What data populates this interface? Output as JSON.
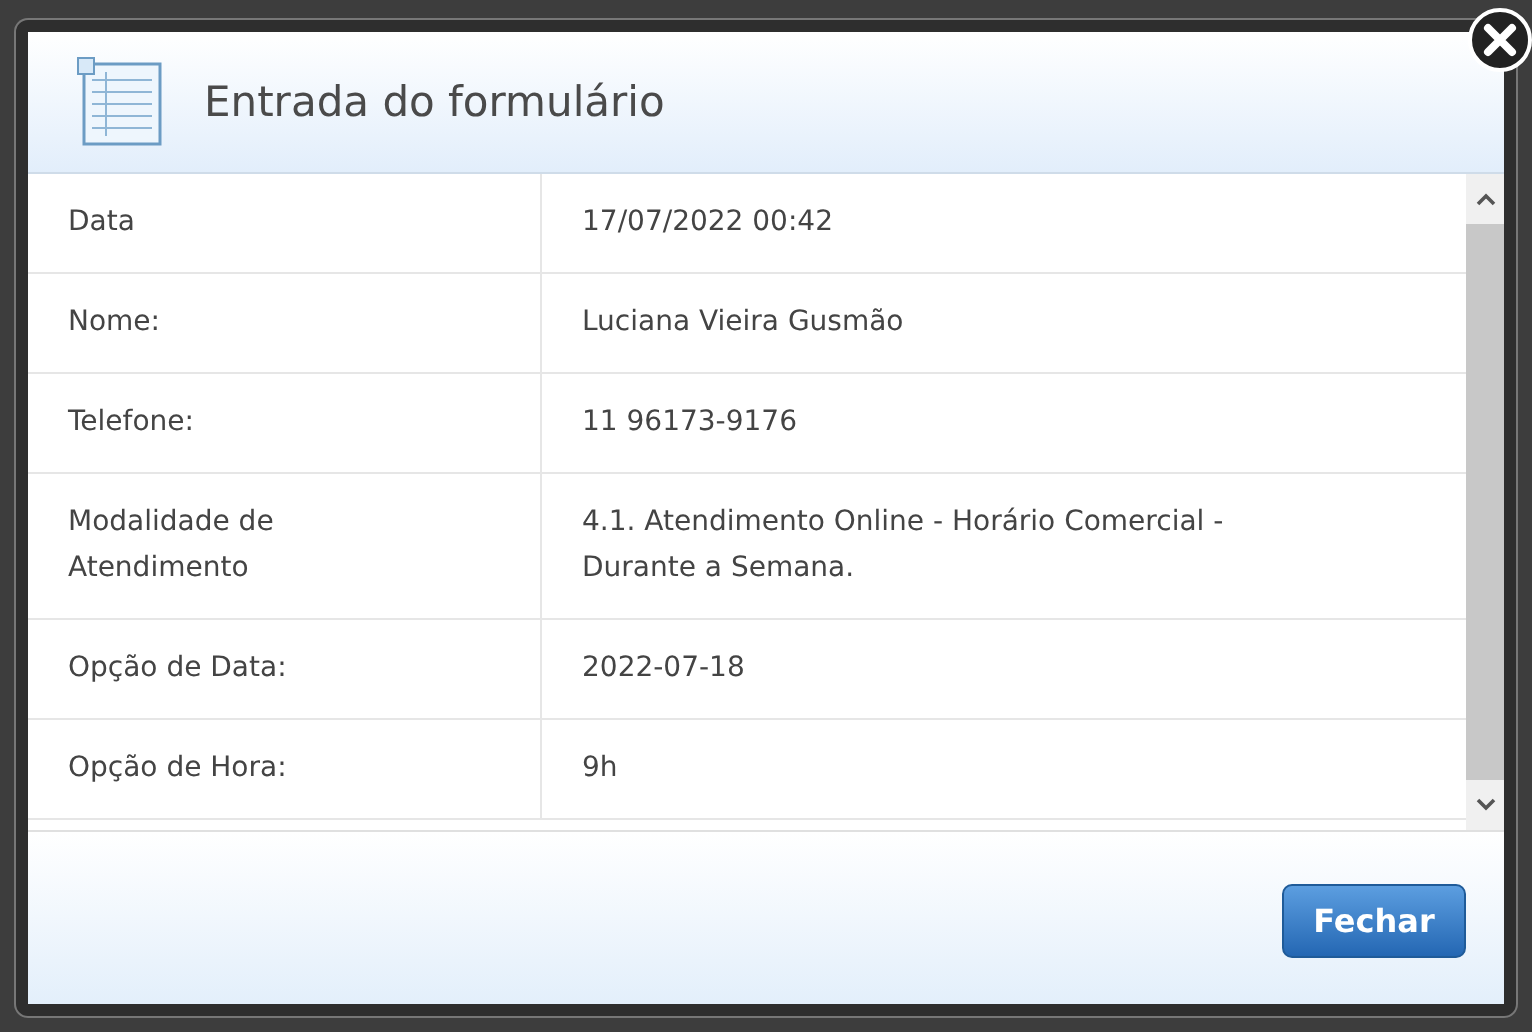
{
  "dialog": {
    "title": "Entrada do formulário",
    "rows": [
      {
        "label": "Data",
        "value": "17/07/2022 00:42"
      },
      {
        "label": "Nome:",
        "value": "Luciana Vieira Gusmão"
      },
      {
        "label": "Telefone:",
        "value": "11 96173-9176"
      },
      {
        "label": "Modalidade de Atendimento",
        "value": "4.1. Atendimento Online - Horário Comercial - Durante a Semana."
      },
      {
        "label": "Opção de Data:",
        "value": "2022-07-18"
      },
      {
        "label": "Opção de Hora:",
        "value": "9h"
      }
    ],
    "buttons": [
      "Fechar"
    ]
  }
}
